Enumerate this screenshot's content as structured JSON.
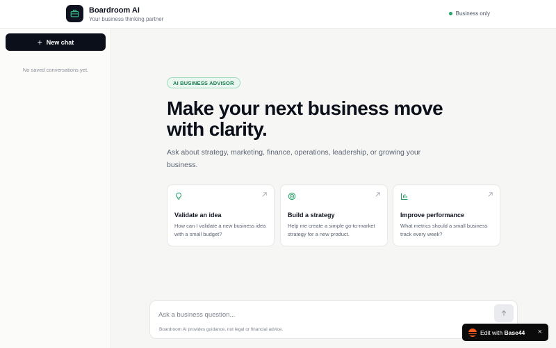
{
  "header": {
    "app_title": "Boardroom AI",
    "app_subtitle": "Your business thinking partner",
    "logo_icon": "briefcase-icon",
    "status_text": "Business only",
    "status_color": "#22a36a"
  },
  "sidebar": {
    "new_chat_label": "New chat",
    "new_chat_icon": "plus-icon",
    "empty_text": "No saved conversations yet."
  },
  "main": {
    "badge": "AI BUSINESS ADVISOR",
    "headline": "Make your next business move with clarity.",
    "subtitle": "Ask about strategy, marketing, finance, operations, leadership, or growing your business.",
    "cards": [
      {
        "icon": "lightbulb-icon",
        "title": "Validate an idea",
        "description": "How can I validate a new business idea with a small budget?"
      },
      {
        "icon": "target-icon",
        "title": "Build a strategy",
        "description": "Help me create a simple go-to-market strategy for a new product."
      },
      {
        "icon": "bar-chart-icon",
        "title": "Improve performance",
        "description": "What metrics should a small business track every week?"
      }
    ]
  },
  "composer": {
    "placeholder": "Ask a business question...",
    "value": "",
    "send_icon": "arrow-up-icon",
    "disclaimer": "Boardroom AI provides guidance, not legal or financial advice."
  },
  "edit_badge": {
    "prefix": "Edit with",
    "brand": "Base44",
    "close_icon": "close-icon"
  },
  "colors": {
    "accent_green": "#177a4d",
    "dark": "#0b0f1a"
  }
}
